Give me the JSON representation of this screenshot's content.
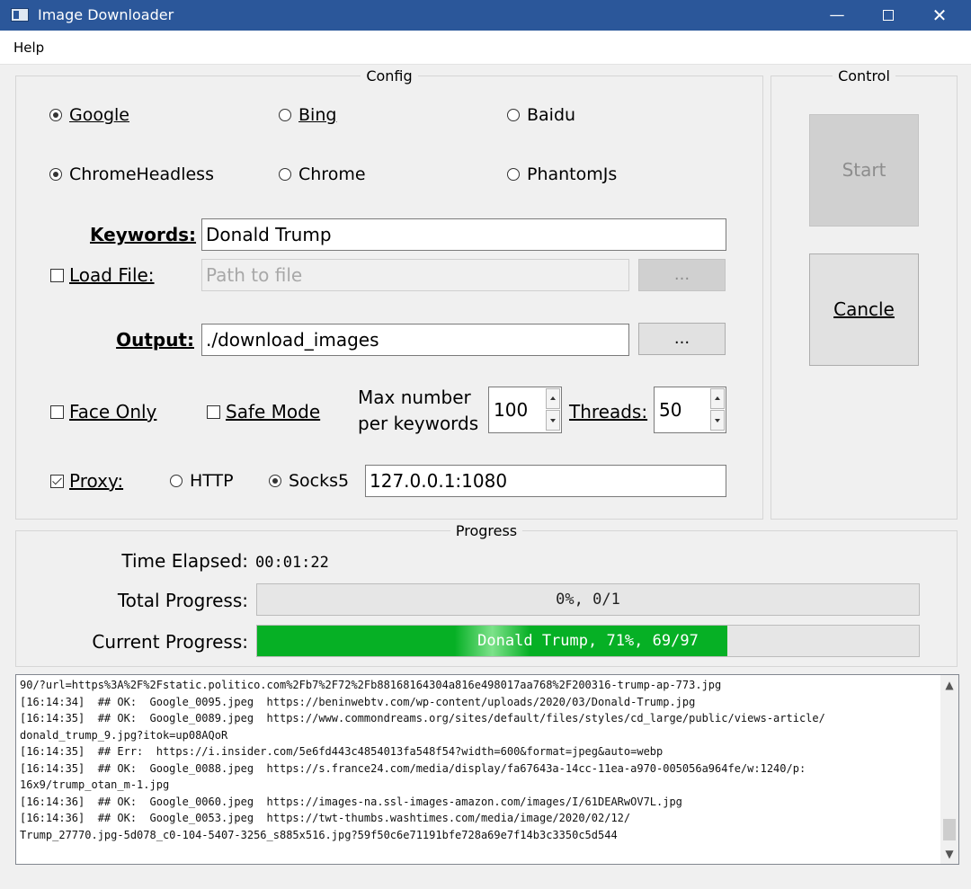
{
  "window": {
    "title": "Image Downloader",
    "icon": "app-window-icon",
    "controls": {
      "minimize": "—",
      "close": "✕"
    }
  },
  "menu": {
    "help": "Help"
  },
  "config": {
    "title": "Config",
    "engines": [
      {
        "label": "Google",
        "checked": true
      },
      {
        "label": "Bing",
        "checked": false
      },
      {
        "label": "Baidu",
        "checked": false
      }
    ],
    "drivers": [
      {
        "label": "ChromeHeadless",
        "checked": true
      },
      {
        "label": "Chrome",
        "checked": false
      },
      {
        "label": "PhantomJs",
        "checked": false
      }
    ],
    "keywords": {
      "label": "Keywords:",
      "value": "Donald Trump"
    },
    "load_file": {
      "label": "Load File:",
      "checked": false,
      "placeholder": "Path to file",
      "browse": "..."
    },
    "output": {
      "label": "Output:",
      "value": "./download_images",
      "browse": "..."
    },
    "face_only": {
      "label": "Face Only",
      "checked": false
    },
    "safe_mode": {
      "label": "Safe Mode",
      "checked": false
    },
    "max_number": {
      "label_line1": "Max number",
      "label_line2": "per keywords",
      "value": "100"
    },
    "threads": {
      "label": "Threads:",
      "value": "50"
    },
    "proxy": {
      "label": "Proxy:",
      "checked": true,
      "http": {
        "label": "HTTP",
        "checked": false
      },
      "socks5": {
        "label": "Socks5",
        "checked": true
      },
      "address": "127.0.0.1:1080"
    }
  },
  "control": {
    "title": "Control",
    "start": "Start",
    "cancel": "Cancle"
  },
  "progress": {
    "title": "Progress",
    "time_label": "Time Elapsed:",
    "time_value": "00:01:22",
    "total_label": "Total Progress:",
    "total_text": "0%,  0/1",
    "total_fraction": 0,
    "current_label": "Current Progress:",
    "current_text": "Donald Trump, 71%, 69/97",
    "current_fraction": 0.71
  },
  "log": {
    "lines": [
      "90/?url=https%3A%2F%2Fstatic.politico.com%2Fb7%2F72%2Fb88168164304a816e498017aa768%2F200316-trump-ap-773.jpg",
      "[16:14:34]  ## OK:  Google_0095.jpeg  https://beninwebtv.com/wp-content/uploads/2020/03/Donald-Trump.jpg",
      "[16:14:35]  ## OK:  Google_0089.jpeg  https://www.commondreams.org/sites/default/files/styles/cd_large/public/views-article/",
      "donald_trump_9.jpg?itok=up08AQoR",
      "[16:14:35]  ## Err:  https://i.insider.com/5e6fd443c4854013fa548f54?width=600&format=jpeg&auto=webp",
      "[16:14:35]  ## OK:  Google_0088.jpeg  https://s.france24.com/media/display/fa67643a-14cc-11ea-a970-005056a964fe/w:1240/p:",
      "16x9/trump_otan_m-1.jpg",
      "[16:14:36]  ## OK:  Google_0060.jpeg  https://images-na.ssl-images-amazon.com/images/I/61DEARwOV7L.jpg",
      "[16:14:36]  ## OK:  Google_0053.jpeg  https://twt-thumbs.washtimes.com/media/image/2020/02/12/",
      "Trump_27770.jpg-5d078_c0-104-5407-3256_s885x516.jpg?59f50c6e71191bfe728a69e7f14b3c3350c5d544"
    ]
  }
}
